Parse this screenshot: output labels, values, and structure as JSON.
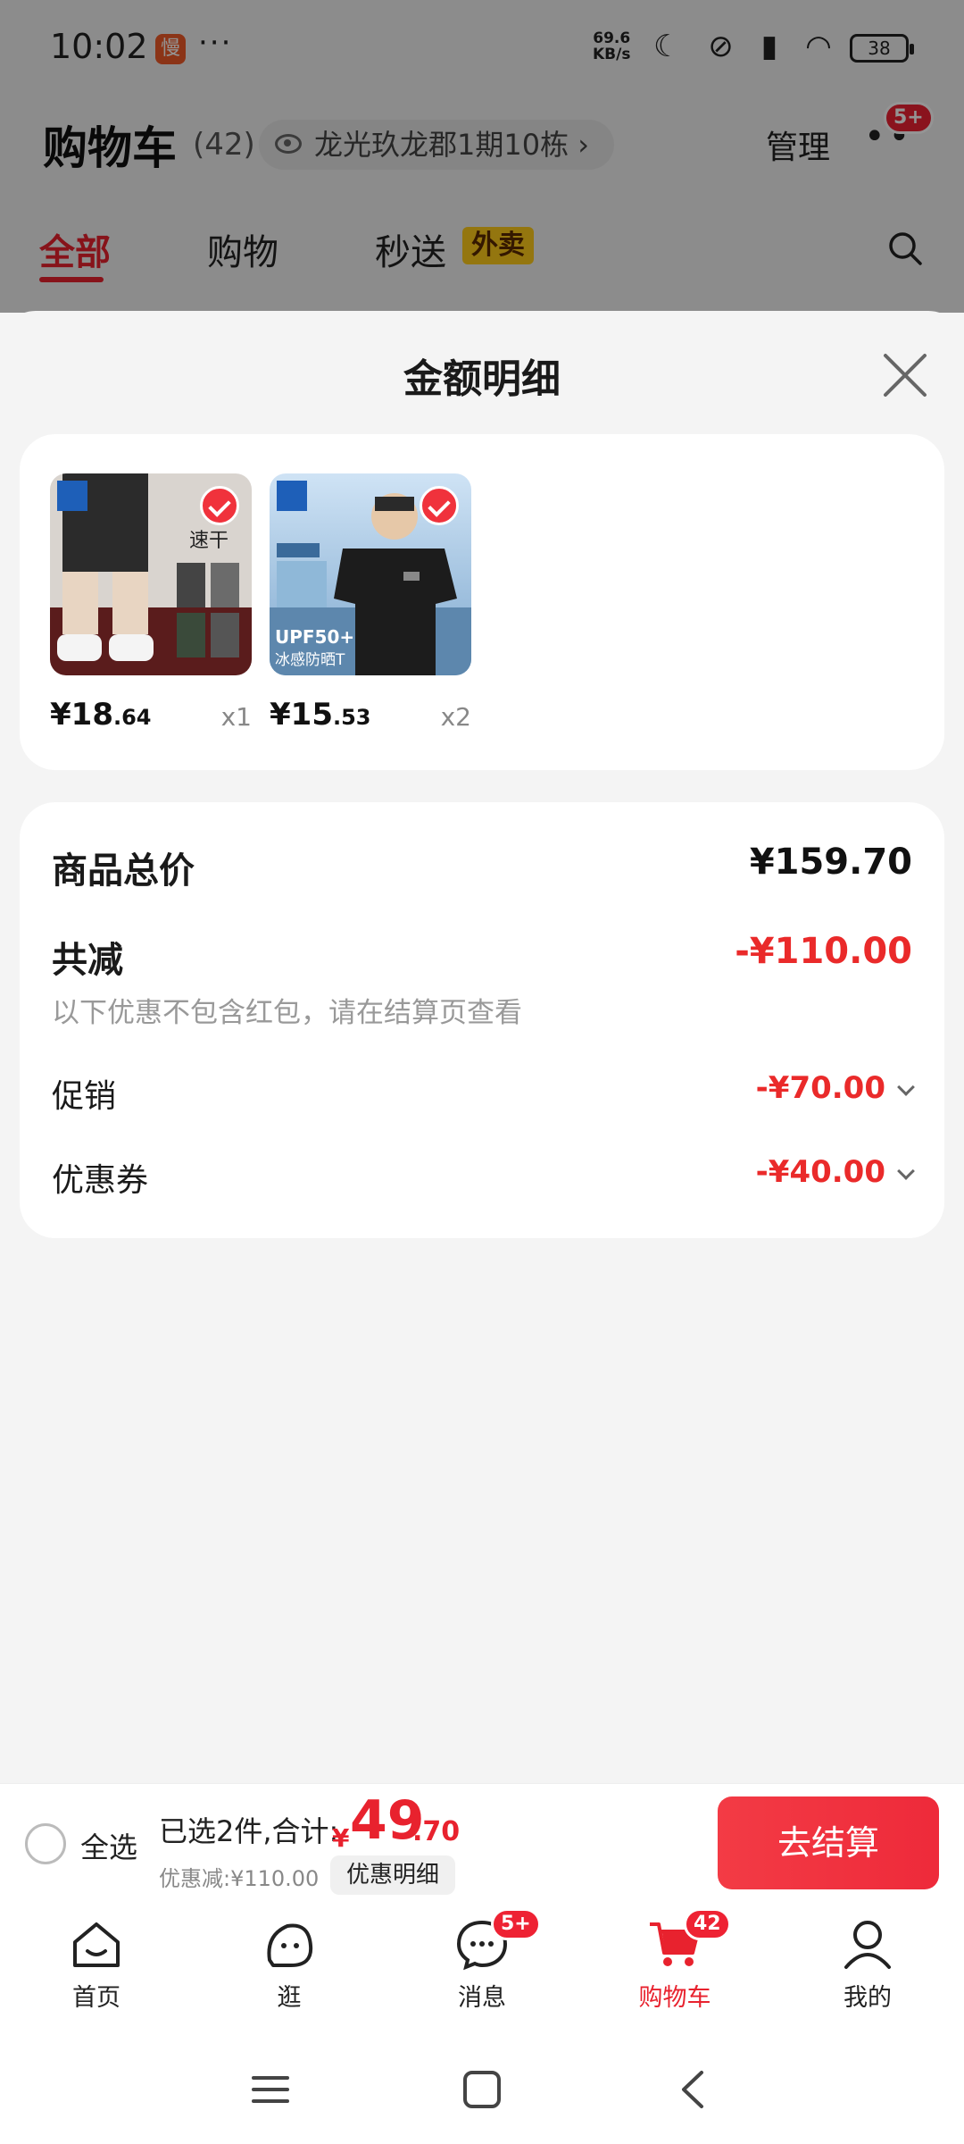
{
  "status_bar": {
    "time": "10:02",
    "app_badge": "慢",
    "dots": "···",
    "net_speed_top": "69.6",
    "net_speed_unit": "KB/s",
    "battery": "38"
  },
  "cart_header": {
    "title": "购物车",
    "count": "(42)",
    "address": "龙光玖龙郡1期10栋",
    "manage_label": "管理",
    "more_badge": "5+"
  },
  "cart_tabs": [
    {
      "label": "全部"
    },
    {
      "label": "购物"
    },
    {
      "label": "秒送"
    }
  ],
  "waimai_tag": "外卖",
  "sheet": {
    "title": "金额明细"
  },
  "products": [
    {
      "price_int": "¥18",
      "price_dec": ".64",
      "qty": "x1"
    },
    {
      "price_int": "¥15",
      "price_dec": ".53",
      "qty": "x2"
    }
  ],
  "summary": {
    "total_label": "商品总价",
    "total_value": "¥159.70",
    "reduce_label": "共减",
    "reduce_value": "-¥110.00",
    "note": "以下优惠不包含红包，请在结算页查看",
    "promo_label": "促销",
    "promo_value": "-¥70.00",
    "coupon_label": "优惠券",
    "coupon_value": "-¥40.00"
  },
  "checkout": {
    "select_all": "全选",
    "selected_text": "已选2件,合计:",
    "total_symbol": "¥",
    "total_int": "49",
    "total_dec": ".70",
    "discount_text": "优惠减:¥110.00",
    "detail_button": "优惠明细",
    "checkout_button": "去结算"
  },
  "bottom_nav": [
    {
      "label": "首页"
    },
    {
      "label": "逛"
    },
    {
      "label": "消息",
      "badge": "5+"
    },
    {
      "label": "购物车",
      "badge": "42"
    },
    {
      "label": "我的"
    }
  ],
  "colors": {
    "accent": "#e8222e",
    "discount_red": "#ea2a2a",
    "tag_yellow": "#ffcc1a"
  }
}
